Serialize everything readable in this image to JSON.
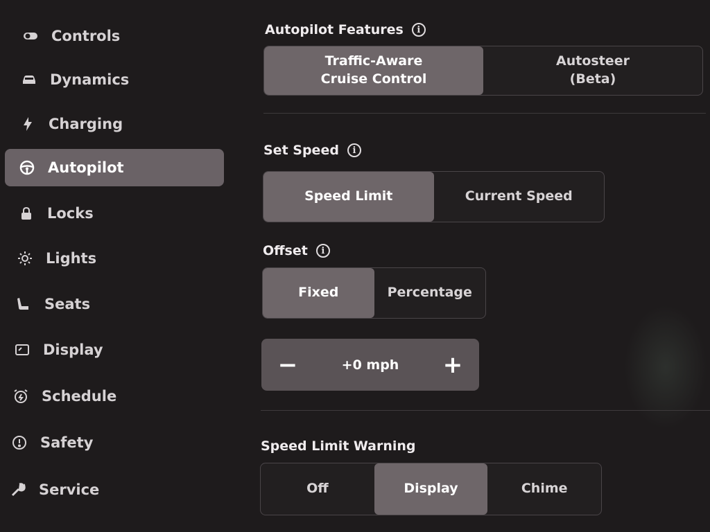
{
  "sidebar": {
    "items": [
      {
        "label": "Controls",
        "icon": "toggle-icon"
      },
      {
        "label": "Dynamics",
        "icon": "car-icon"
      },
      {
        "label": "Charging",
        "icon": "lightning-icon"
      },
      {
        "label": "Autopilot",
        "icon": "steering-wheel-icon",
        "active": true
      },
      {
        "label": "Locks",
        "icon": "lock-icon"
      },
      {
        "label": "Lights",
        "icon": "sun-icon"
      },
      {
        "label": "Seats",
        "icon": "seat-icon"
      },
      {
        "label": "Display",
        "icon": "display-icon"
      },
      {
        "label": "Schedule",
        "icon": "alarm-clock-icon"
      },
      {
        "label": "Safety",
        "icon": "alert-circle-icon"
      },
      {
        "label": "Service",
        "icon": "wrench-icon"
      }
    ]
  },
  "autopilot_features": {
    "title": "Autopilot Features",
    "options": [
      "Traffic-Aware\nCruise Control",
      "Autosteer\n(Beta)"
    ],
    "selected": "Traffic-Aware\nCruise Control"
  },
  "set_speed": {
    "title": "Set Speed",
    "options": [
      "Speed Limit",
      "Current Speed"
    ],
    "selected": "Speed Limit"
  },
  "offset": {
    "title": "Offset",
    "options": [
      "Fixed",
      "Percentage"
    ],
    "selected": "Fixed",
    "stepper": {
      "minus": "−",
      "value": "+0 mph",
      "plus": "+"
    }
  },
  "speed_limit_warning": {
    "title": "Speed Limit Warning",
    "options": [
      "Off",
      "Display",
      "Chime"
    ],
    "selected": "Display"
  },
  "colors": {
    "selected_bg": "#6e6669",
    "background": "#1e1b1c",
    "active_sidebar": "#6a6266"
  }
}
